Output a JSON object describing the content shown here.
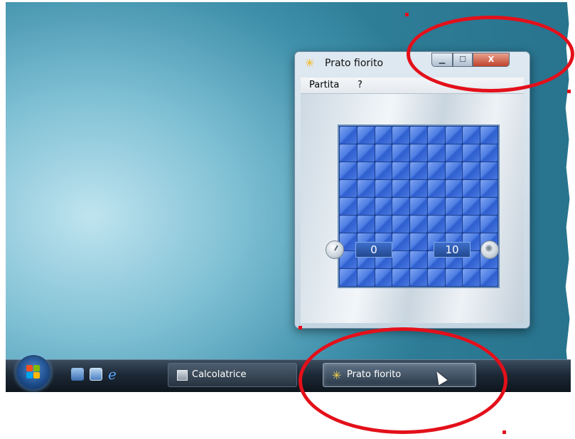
{
  "window": {
    "title": "Prato fiorito",
    "title_icon": "flower-icon",
    "controls": {
      "minimize_icon": "minimize-icon",
      "maximize_icon": "maximize-icon",
      "close_label": "X"
    }
  },
  "menubar": {
    "items": [
      "Partita",
      "?"
    ]
  },
  "game": {
    "grid_rows": 9,
    "grid_cols": 9,
    "timer_value": "0",
    "mines_value": "10",
    "timer_icon": "clock-icon",
    "mines_icon": "mine-icon"
  },
  "taskbar": {
    "start_icon": "windows-start-icon",
    "quick_launch": [
      "show-desktop-icon",
      "switch-windows-icon",
      "internet-explorer-icon"
    ],
    "buttons": [
      {
        "label": "Calcolatrice",
        "icon": "calculator-icon",
        "active": false
      },
      {
        "label": "Prato fiorito",
        "icon": "flower-icon",
        "active": true
      }
    ]
  },
  "colors": {
    "highlight": "#e3101a",
    "tile": "#4f7fe3",
    "desktop": "#3f90ab"
  }
}
